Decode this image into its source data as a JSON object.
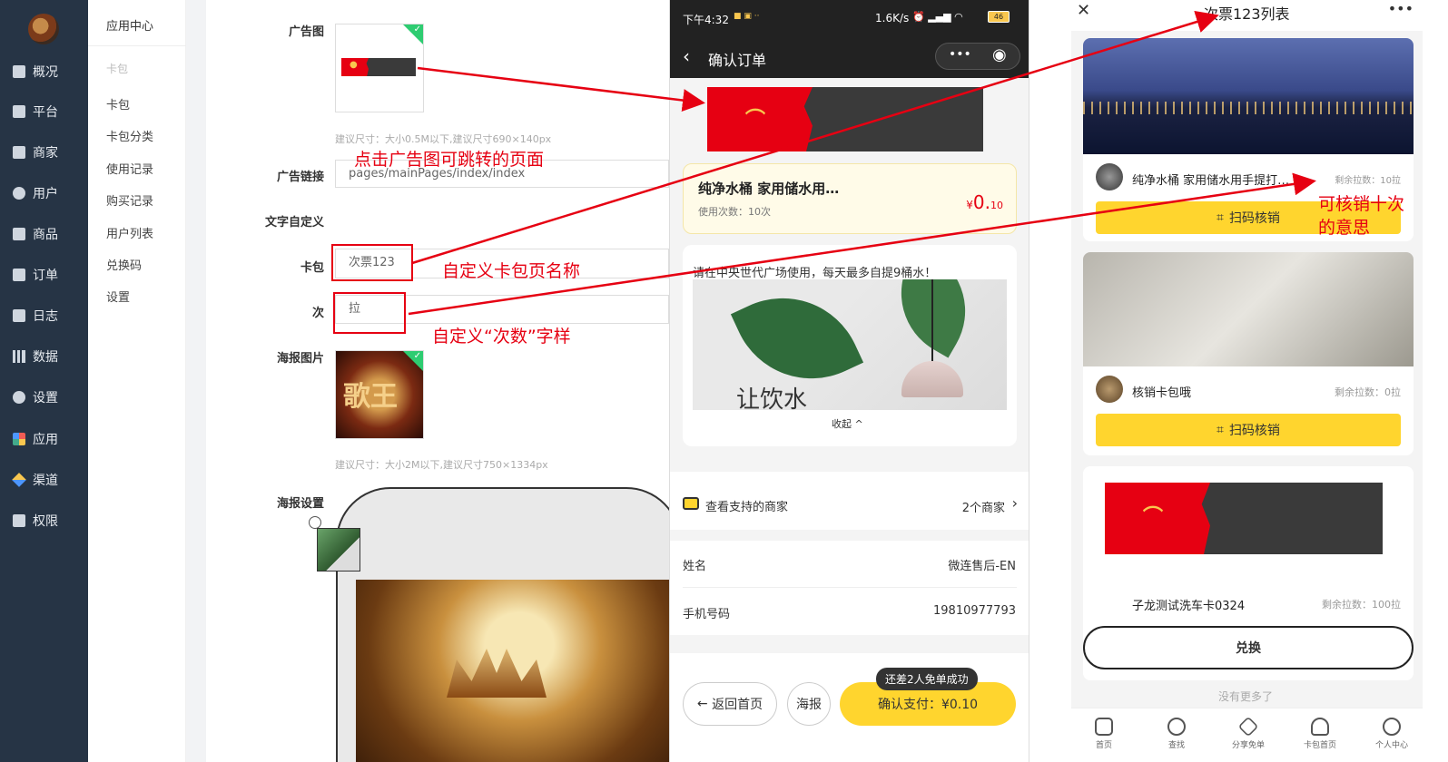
{
  "nav": {
    "items": [
      "概况",
      "平台",
      "商家",
      "用户",
      "商品",
      "订单",
      "日志",
      "数据",
      "设置",
      "应用",
      "渠道",
      "权限"
    ]
  },
  "subnav": {
    "title": "应用中心",
    "group": "卡包",
    "items": [
      "卡包",
      "卡包分类",
      "使用记录",
      "购买记录",
      "用户列表",
      "兑换码",
      "设置"
    ]
  },
  "form": {
    "ad_image_label": "广告图",
    "ad_image_hint": "建议尺寸：大小0.5M以下,建议尺寸690×140px",
    "ad_link_label": "广告链接",
    "ad_link_value": "pages/mainPages/index/index",
    "custom_text_label": "文字自定义",
    "card_label": "卡包",
    "card_value": "次票123",
    "times_label": "次",
    "times_value": "拉",
    "poster_image_label": "海报图片",
    "poster_thumb_text": "歌王",
    "poster_hint": "建议尺寸：大小2M以下,建议尺寸750×1334px",
    "poster_settings_label": "海报设置"
  },
  "annotations": {
    "ad_jump": "点击广告图可跳转的页面",
    "card_name": "自定义卡包页名称",
    "times_text": "自定义“次数”字样",
    "ten_times": "可核销十次",
    "meaning": "的意思"
  },
  "phone": {
    "time": "下午4:32",
    "status_right": "1.6K/s",
    "battery": "46",
    "title": "确认订单",
    "goods_name": "纯净水桶 家用储水用…",
    "usage": "使用次数：10次",
    "price_symbol": "¥",
    "price_int": "0.",
    "price_dec": "10",
    "description": "请在中央世代广场使用，每天最多自提9桶水！",
    "image_caption": "让饮水",
    "collapse": "收起",
    "merchants_label": "查看支持的商家",
    "merchants_count": "2个商家",
    "name_label": "姓名",
    "name_value": "微连售后-EN",
    "phone_label": "手机号码",
    "phone_value": "19810977793",
    "home_button": "返回首页",
    "poster_button": "海报",
    "pay_button": "确认支付：¥0.10",
    "tooltip": "还差2人免单成功"
  },
  "right": {
    "title": "次票123列表",
    "cards": [
      {
        "name": "纯净水桶 家用储水用手提打…",
        "remain": "剩余拉数：10拉",
        "button": "扫码核销"
      },
      {
        "name": "核销卡包哦",
        "remain": "剩余拉数：0拉",
        "button": "扫码核销"
      },
      {
        "name": "子龙测试洗车卡0324",
        "remain": "剩余拉数：100拉",
        "button": "兑换"
      }
    ],
    "no_more": "没有更多了",
    "tabs": [
      "首页",
      "查找",
      "分享免单",
      "卡包首页",
      "个人中心"
    ]
  },
  "colors": {
    "accent_red": "#e60012",
    "brand_yellow": "#ffd52e",
    "nav_dark": "#263445"
  }
}
